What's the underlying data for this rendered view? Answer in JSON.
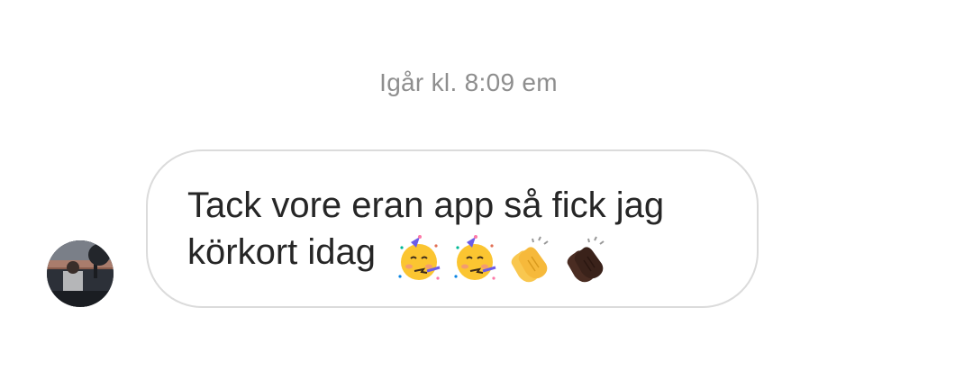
{
  "thread": {
    "timestamp": "Igår kl. 8:09 em"
  },
  "message": {
    "sender_avatar": "avatar-photo",
    "text_line_1": "Tack vore eran app så fick jag",
    "text_line_2": "körkort idag",
    "emojis": [
      "partying-face-icon",
      "partying-face-icon",
      "clapping-hands-icon",
      "clapping-hands-dark-icon"
    ]
  },
  "colors": {
    "timestamp": "#8e8e8e",
    "bubble_border": "#dbdbdb",
    "text": "#262626",
    "background": "#ffffff"
  }
}
